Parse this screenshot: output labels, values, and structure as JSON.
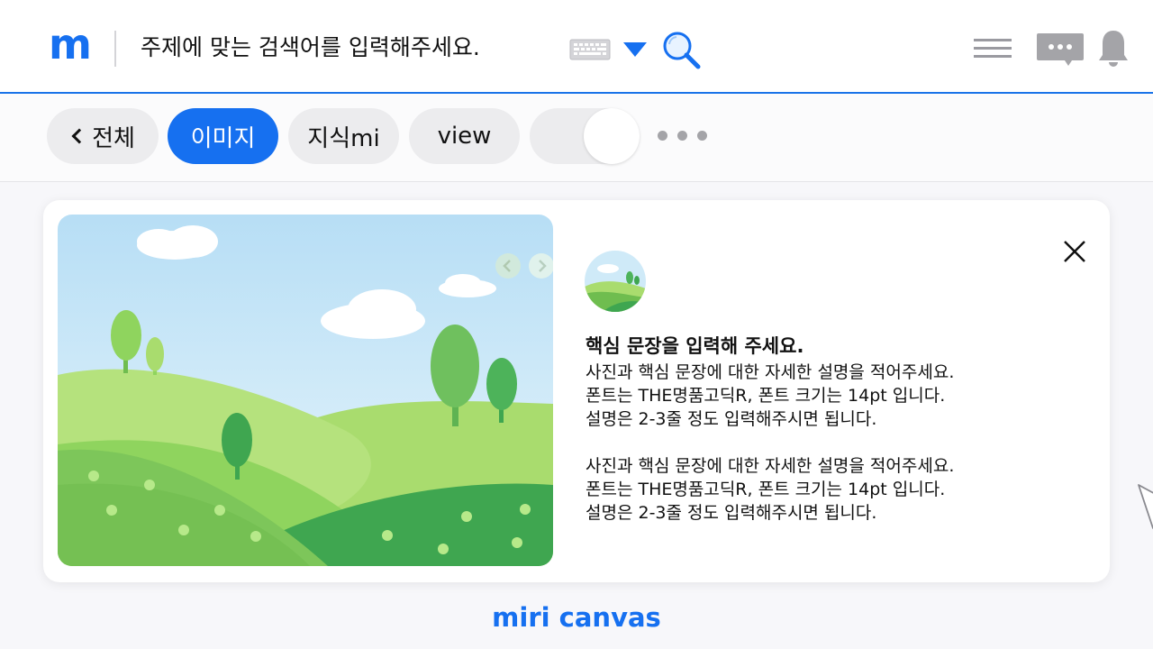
{
  "header": {
    "logo": "m",
    "search_text": "주제에 맞는 검색어를 입력해주세요."
  },
  "tabs": [
    {
      "label": "전체"
    },
    {
      "label": "이미지"
    },
    {
      "label": "지식mi"
    },
    {
      "label": "view"
    }
  ],
  "card": {
    "headline": "핵심 문장을 입력해 주세요.",
    "paragraphs": [
      {
        "line1": "사진과 핵심 문장에 대한 자세한 설명을 적어주세요.",
        "line2": "폰트는 THE명품고딕R, 폰트 크기는 14pt 입니다.",
        "line3": "설명은 2-3줄 정도 입력해주시면 됩니다."
      },
      {
        "line1": "사진과 핵심 문장에 대한 자세한 설명을 적어주세요.",
        "line2": "폰트는 THE명품고딕R, 폰트 크기는 14pt 입니다.",
        "line3": "설명은 2-3줄 정도 입력해주시면 됩니다."
      }
    ]
  },
  "brand": "miri canvas",
  "colors": {
    "accent": "#1670f0",
    "chip_bg": "#ececee",
    "sky": "#bfe3f7",
    "grass_light": "#8fd45e",
    "grass_dark": "#3fa650"
  },
  "icons": [
    "keyboard-icon",
    "dropdown-triangle-icon",
    "search-icon",
    "hamburger-menu-icon",
    "chat-bubble-icon",
    "bell-icon",
    "chevron-left-icon",
    "more-dots-icon",
    "close-icon",
    "cursor-arrow-icon"
  ]
}
